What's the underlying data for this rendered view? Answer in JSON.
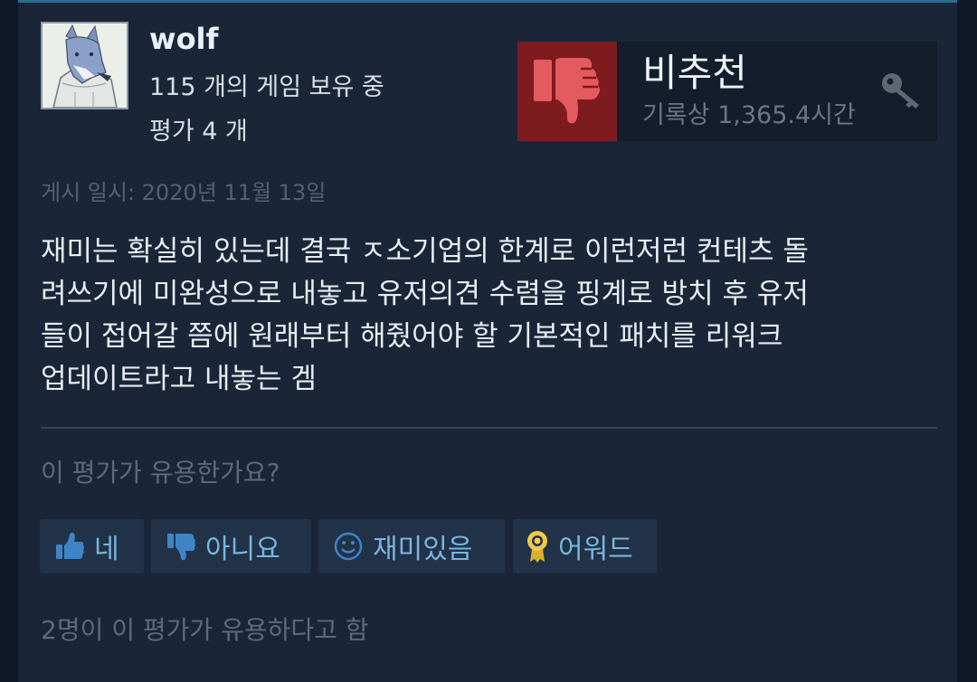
{
  "reviewer": {
    "name": "wolf",
    "games_owned": "115 개의 게임 보유 중",
    "reviews_count": "평가 4 개"
  },
  "verdict": {
    "label": "비추천",
    "playtime": "기록상 1,365.4시간",
    "thumb_icon": "thumbs-down-icon",
    "accent_color": "#7d1b1f"
  },
  "review": {
    "posted": "게시 일시: 2020년 11월 13일",
    "lines": [
      "재미는 확실히 있는데 결국 ㅈ소기업의 한계로 이런저런 컨테츠 돌",
      "려쓰기에 미완성으로 내놓고 유저의견 수렴을 핑계로 방치 후 유저",
      "들이 접어갈 쯤에 원래부터 해줬어야 할 기본적인 패치를 리워크",
      "업데이트라고 내놓는 겜"
    ]
  },
  "feedback": {
    "question": "이 평가가 유용한가요?",
    "yes_label": "네",
    "no_label": "아니요",
    "funny_label": "재미있음",
    "award_label": "어워드",
    "helpful_count": "2명이 이 평가가 유용하다고 함"
  },
  "colors": {
    "background": "#0f1826",
    "card": "#1a2638",
    "button_text": "#79b6de"
  }
}
